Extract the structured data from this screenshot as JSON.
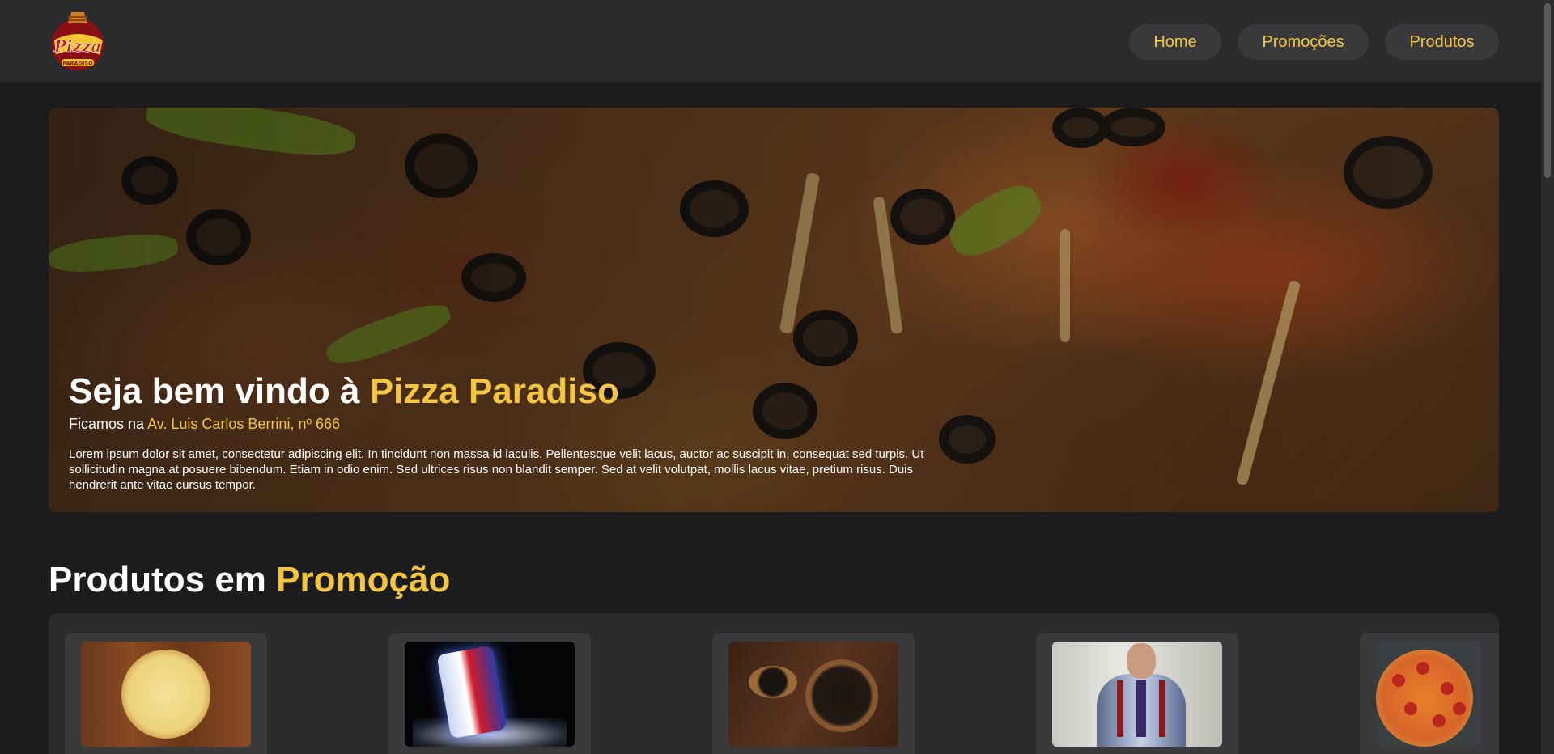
{
  "header": {
    "logo_text": "Pizza",
    "logo_subtext": "PARADISO",
    "nav": {
      "home": "Home",
      "promocoes": "Promoções",
      "produtos": "Produtos"
    }
  },
  "hero": {
    "title_prefix": "Seja bem vindo à ",
    "title_accent": "Pizza Paradiso",
    "subtitle_prefix": "Ficamos na ",
    "subtitle_accent": "Av. Luis Carlos Berrini, nº 666",
    "text": "Lorem ipsum dolor sit amet, consectetur adipiscing elit. In tincidunt non massa id iaculis. Pellentesque velit lacus, auctor ac suscipit in, consequat sed turpis. Ut sollicitudin magna at posuere bibendum. Etiam in odio enim. Sed ultrices risus non blandit semper. Sed at velit volutpat, mollis lacus vitae, pretium risus. Duis hendrerit ante vitae cursus tempor."
  },
  "promo_section": {
    "title_prefix": "Produtos em ",
    "title_accent": "Promoção"
  },
  "products": [
    {
      "image": "cheese-pizza"
    },
    {
      "image": "soda-can"
    },
    {
      "image": "black-spice-bowl"
    },
    {
      "image": "man-in-suit"
    },
    {
      "image": "pepperoni-pizza"
    }
  ],
  "colors": {
    "accent": "#f4c542",
    "background": "#1c1c1e",
    "surface": "#2b2b2d",
    "card": "#3a3a3c"
  }
}
